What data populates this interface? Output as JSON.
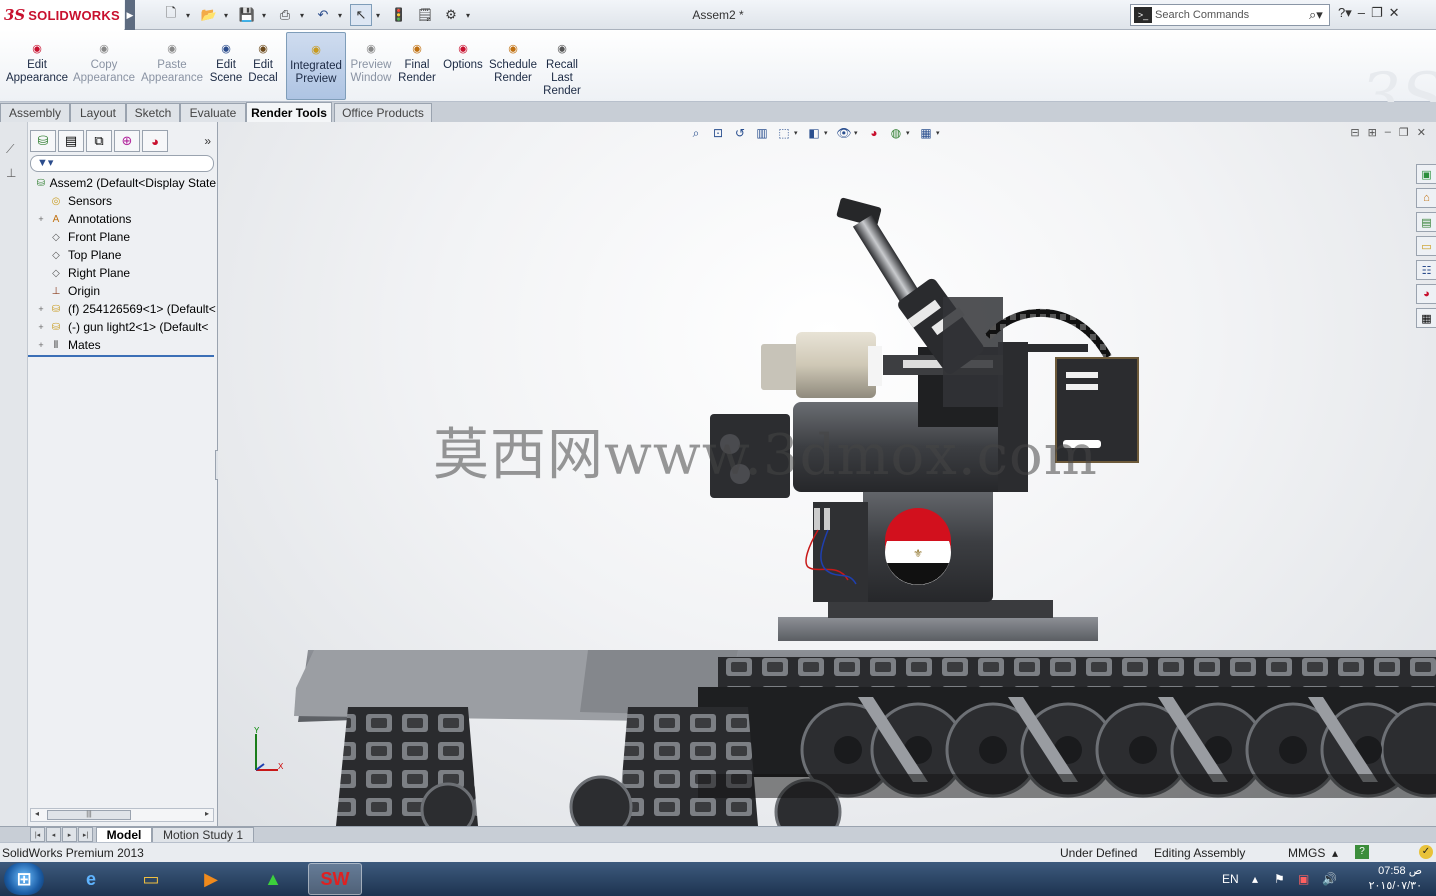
{
  "app": {
    "brand": "SOLIDWORKS",
    "document_title": "Assem2 *",
    "search_placeholder": "Search Commands"
  },
  "colors": {
    "brand_red": "#c8102e",
    "active_tab": "#b8cbe6",
    "tree_separator": "#3b6fb6",
    "taskbar": "#1d3350"
  },
  "quick_access": [
    "new-icon",
    "open-icon",
    "save-icon",
    "print-icon",
    "undo-icon",
    "select-icon",
    "rebuild-icon",
    "file-properties-icon",
    "options-icon"
  ],
  "ribbon": {
    "buttons": [
      {
        "label": "Edit Appearance",
        "icon": "edit-appearance-icon",
        "enabled": true
      },
      {
        "label": "Copy Appearance",
        "icon": "copy-appearance-icon",
        "enabled": false
      },
      {
        "label": "Paste Appearance",
        "icon": "paste-appearance-icon",
        "enabled": false
      },
      {
        "label": "Edit Scene",
        "icon": "edit-scene-icon",
        "enabled": true
      },
      {
        "label": "Edit Decal",
        "icon": "edit-decal-icon",
        "enabled": true
      },
      {
        "label": "Integrated Preview",
        "icon": "integrated-preview-icon",
        "enabled": true,
        "active": true
      },
      {
        "label": "Preview Window",
        "icon": "preview-window-icon",
        "enabled": false
      },
      {
        "label": "Final Render",
        "icon": "final-render-icon",
        "enabled": true
      },
      {
        "label": "Options",
        "icon": "options-icon",
        "enabled": true
      },
      {
        "label": "Schedule Render",
        "icon": "schedule-render-icon",
        "enabled": true
      },
      {
        "label": "Recall Last Render",
        "icon": "recall-last-render-icon",
        "enabled": true
      }
    ]
  },
  "command_tabs": [
    {
      "label": "Assembly",
      "active": false
    },
    {
      "label": "Layout",
      "active": false
    },
    {
      "label": "Sketch",
      "active": false
    },
    {
      "label": "Evaluate",
      "active": false
    },
    {
      "label": "Render Tools",
      "active": true
    },
    {
      "label": "Office Products",
      "active": false
    }
  ],
  "feature_tree": {
    "nodes": [
      {
        "label": "Assem2  (Default<Display State",
        "icon": "assembly-icon",
        "expander": ""
      },
      {
        "label": "Sensors",
        "icon": "sensors-icon",
        "expander": ""
      },
      {
        "label": "Annotations",
        "icon": "annotations-icon",
        "expander": "+"
      },
      {
        "label": "Front Plane",
        "icon": "plane-icon",
        "expander": ""
      },
      {
        "label": "Top Plane",
        "icon": "plane-icon",
        "expander": ""
      },
      {
        "label": "Right Plane",
        "icon": "plane-icon",
        "expander": ""
      },
      {
        "label": "Origin",
        "icon": "origin-icon",
        "expander": ""
      },
      {
        "label": "(f) 254126569<1> (Default<",
        "icon": "subassembly-icon",
        "expander": "+"
      },
      {
        "label": "(-) gun light2<1> (Default<",
        "icon": "subassembly-icon",
        "expander": "+"
      },
      {
        "label": "Mates",
        "icon": "mates-icon",
        "expander": "+"
      }
    ]
  },
  "viewport": {
    "watermark": "莫西网www.3dmox.com",
    "triad_x": "X",
    "triad_y": "Y"
  },
  "model_tabs": [
    {
      "label": "Model",
      "active": true
    },
    {
      "label": "Motion Study 1",
      "active": false
    }
  ],
  "status_bar": {
    "product": "SolidWorks Premium 2013",
    "state": "Under Defined",
    "mode": "Editing Assembly",
    "units": "MMGS"
  },
  "taskbar": {
    "language": "EN",
    "time": "07:58 ص",
    "date": "٢٠١٥/٠٧/٣٠",
    "apps": [
      "ie-icon",
      "explorer-icon",
      "media-player-icon",
      "green-app-icon",
      "solidworks-icon"
    ]
  }
}
